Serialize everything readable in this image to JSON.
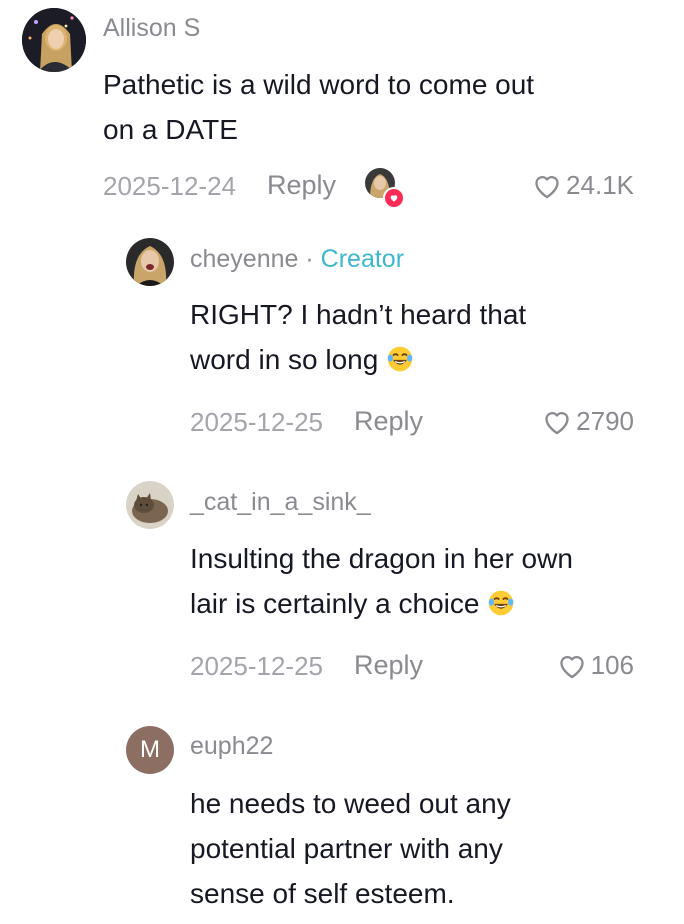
{
  "comments": [
    {
      "username": "Allison S",
      "text_lines": [
        "Pathetic is a wild word to come out",
        "on a DATE"
      ],
      "date": "2025-12-24",
      "reply_label": "Reply",
      "likes": "24.1K",
      "avatar_icon": "user-photo"
    },
    {
      "username": "cheyenne",
      "separator": "·",
      "badge": "Creator",
      "text_lines": [
        "RIGHT? I hadn’t heard that",
        "word in so long"
      ],
      "date": "2025-12-25",
      "reply_label": "Reply",
      "likes": "2790",
      "emoji_icon": "laughing-tears-emoji"
    },
    {
      "username": "_cat_in_a_sink_",
      "text_lines": [
        "Insulting the dragon in her own",
        "lair is certainly a choice"
      ],
      "date": "2025-12-25",
      "reply_label": "Reply",
      "likes": "106",
      "emoji_icon": "laughing-tears-emoji"
    },
    {
      "username": "euph22",
      "avatar_letter": "M",
      "text_lines": [
        "he needs to weed out any",
        "potential partner with any",
        "sense of self esteem."
      ]
    }
  ],
  "colors": {
    "text": "#161823",
    "meta": "#a4a5ab",
    "creator_badge": "#3cb7cf",
    "liked_heart": "#fe2c55",
    "letter_avatar_bg": "#8d6e63"
  }
}
